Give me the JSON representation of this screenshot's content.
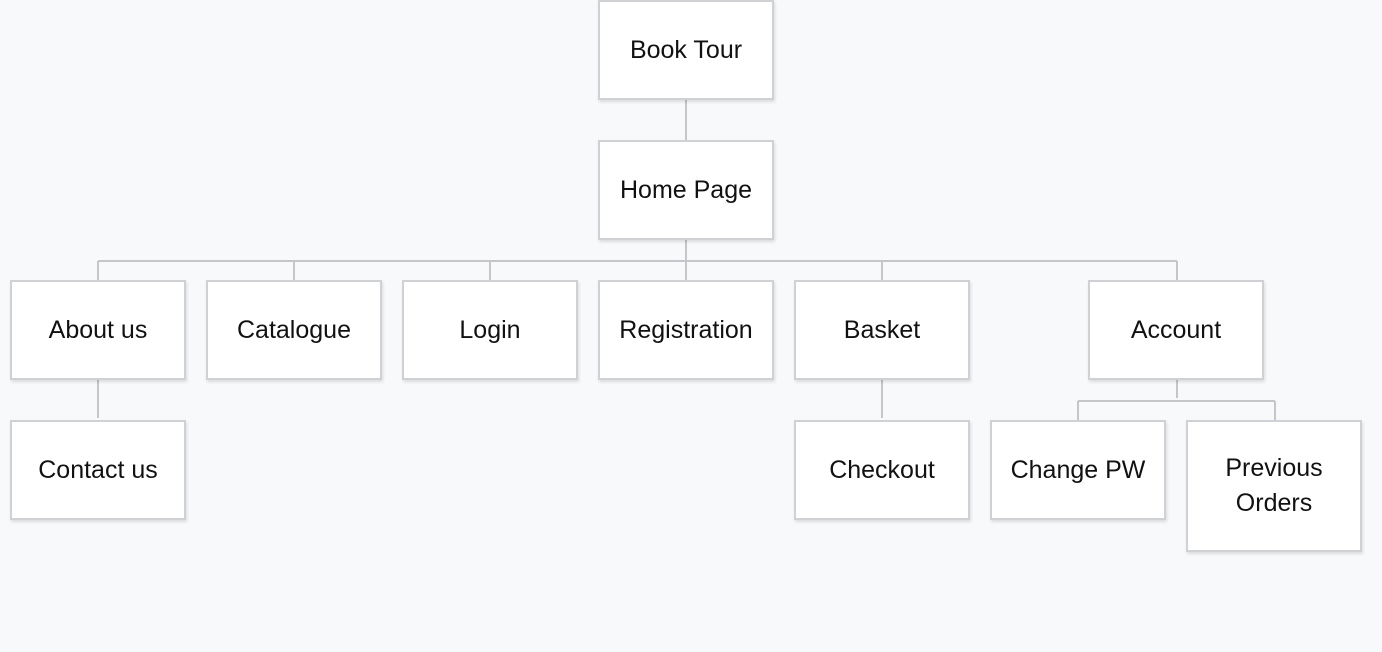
{
  "sitemap": {
    "book_tour": "Book Tour",
    "home_page": "Home Page",
    "about_us": "About us",
    "catalogue": "Catalogue",
    "login": "Login",
    "registration": "Registration",
    "basket": "Basket",
    "account": "Account",
    "contact_us": "Contact us",
    "checkout": "Checkout",
    "change_pw": "Change PW",
    "previous_orders": "Previous Orders"
  },
  "colors": {
    "background": "#f8f9fb",
    "node_fill": "#ffffff",
    "node_border": "#cfd1d4",
    "connector": "#c4c6c9",
    "text": "#111111"
  }
}
